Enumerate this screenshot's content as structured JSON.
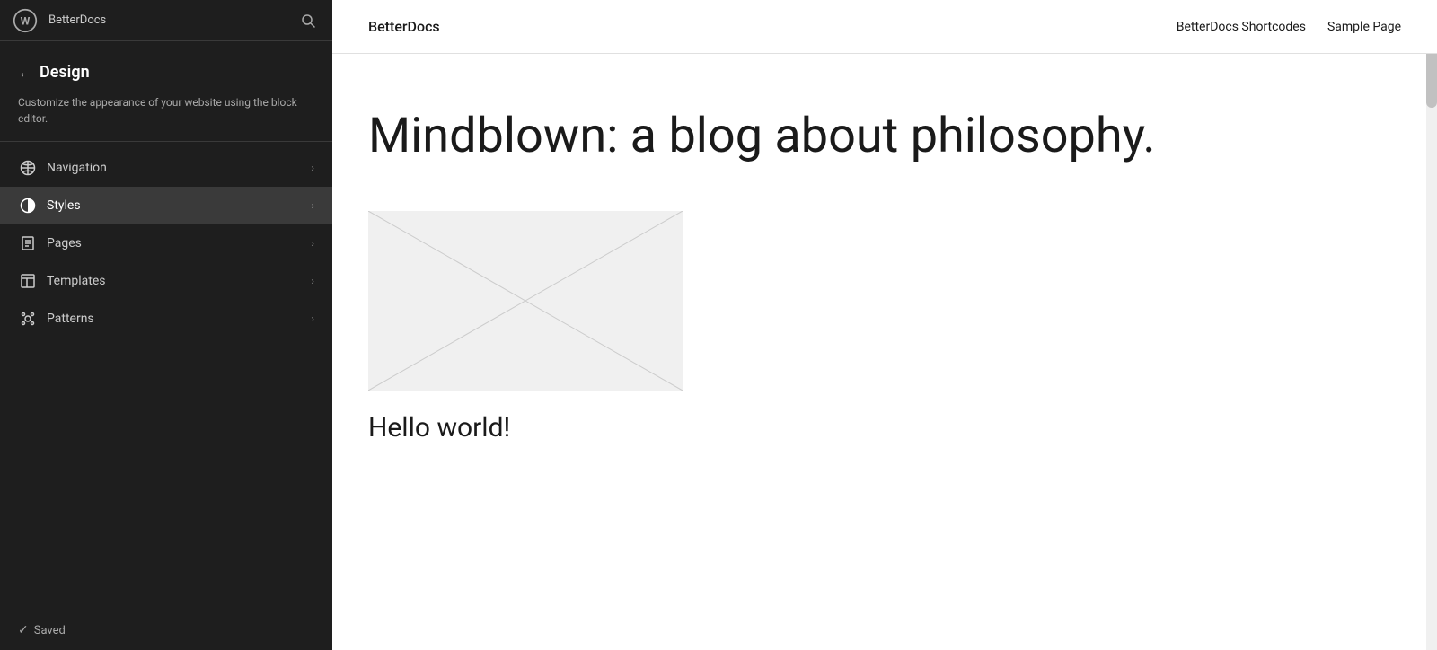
{
  "topbar": {
    "site_name": "BetterDocs",
    "search_icon": "search"
  },
  "sidebar": {
    "back_label": "←",
    "title": "Design",
    "description": "Customize the appearance of your website using the block editor.",
    "nav_items": [
      {
        "id": "navigation",
        "label": "Navigation",
        "icon": "navigation",
        "active": false
      },
      {
        "id": "styles",
        "label": "Styles",
        "icon": "styles",
        "active": true
      },
      {
        "id": "pages",
        "label": "Pages",
        "icon": "pages",
        "active": false
      },
      {
        "id": "templates",
        "label": "Templates",
        "icon": "templates",
        "active": false
      },
      {
        "id": "patterns",
        "label": "Patterns",
        "icon": "patterns",
        "active": false
      }
    ],
    "footer": {
      "status": "Saved",
      "icon": "check"
    }
  },
  "preview": {
    "header": {
      "logo": "BetterDocs",
      "nav": [
        {
          "label": "BetterDocs Shortcodes"
        },
        {
          "label": "Sample Page"
        }
      ]
    },
    "hero_title": "Mindblown: a blog about philosophy.",
    "post": {
      "title": "Hello world!"
    }
  }
}
